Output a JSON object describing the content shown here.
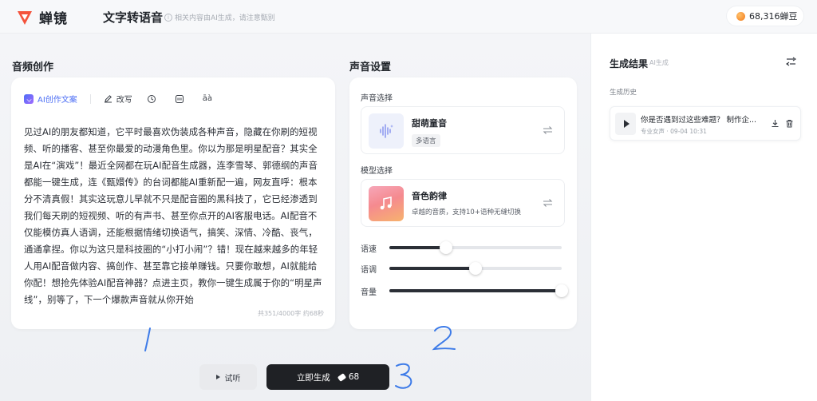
{
  "header": {
    "logo_text": "蝉镜",
    "page_title": "文字转语音",
    "page_hint": "相关内容由AI生成，请注意甄别",
    "coins": "68,316蝉豆"
  },
  "audio_creation": {
    "title": "音频创作",
    "toolbar": {
      "ai_copy": "AI创作文案",
      "rewrite": "改写",
      "pinyin_label": "āà"
    },
    "text": "见过AI的朋友都知道，它平时最喜欢伪装成各种声音，隐藏在你刷的短视频、听的播客、甚至你最爱的动漫角色里。你以为那是明星配音？其实全是AI在“演戏”！最近全网都在玩AI配音生成器，连李雪琴、郭德纲的声音都能一键生成，连《甄嬛传》的台词都能AI重新配一遍，网友直呼：根本分不清真假！其实这玩意儿早就不只是配音圈的黑科技了，它已经渗透到我们每天刷的短视频、听的有声书、甚至你点开的AI客服电话。AI配音不仅能模仿真人语调，还能根据情绪切换语气，搞笑、深情、冷酷、丧气，通通拿捏。你以为这只是科技圈的“小打小闹”？错！现在越来越多的年轻人用AI配音做内容、搞创作、甚至靠它接单赚钱。只要你敢想，AI就能给你配！想抢先体验AI配音神器？点进主页，教你一键生成属于你的“明星声线”，别等了，下一个爆款声音就从你开始",
    "counter": "共351/4000字 约68秒"
  },
  "voice_settings": {
    "title": "声音设置",
    "voice_select_label": "声音选择",
    "voice": {
      "name": "甜萌童音",
      "tag": "多语言"
    },
    "model_select_label": "模型选择",
    "model": {
      "name": "音色韵律",
      "desc": "卓越的音质，支持10+语种无缝切换"
    },
    "sliders": [
      {
        "label": "语速",
        "value": 0.33
      },
      {
        "label": "语调",
        "value": 0.5
      },
      {
        "label": "音量",
        "value": 1.0
      }
    ]
  },
  "actions": {
    "preview": "试听",
    "generate": "立即生成",
    "generate_cost": "68"
  },
  "annotations": [
    "1",
    "2",
    "3"
  ],
  "results": {
    "title": "生成结果",
    "subtitle": "AI生成",
    "history_label": "生成历史",
    "items": [
      {
        "title": "你是否遇到过这些难题？ 制作企...",
        "meta": "专业女声 · 09-04 10:31"
      }
    ]
  },
  "colors": {
    "accent": "#4c6ef5",
    "primary_button": "#1f2125",
    "logo": "#f4533c",
    "annotation": "#3d7be8"
  }
}
